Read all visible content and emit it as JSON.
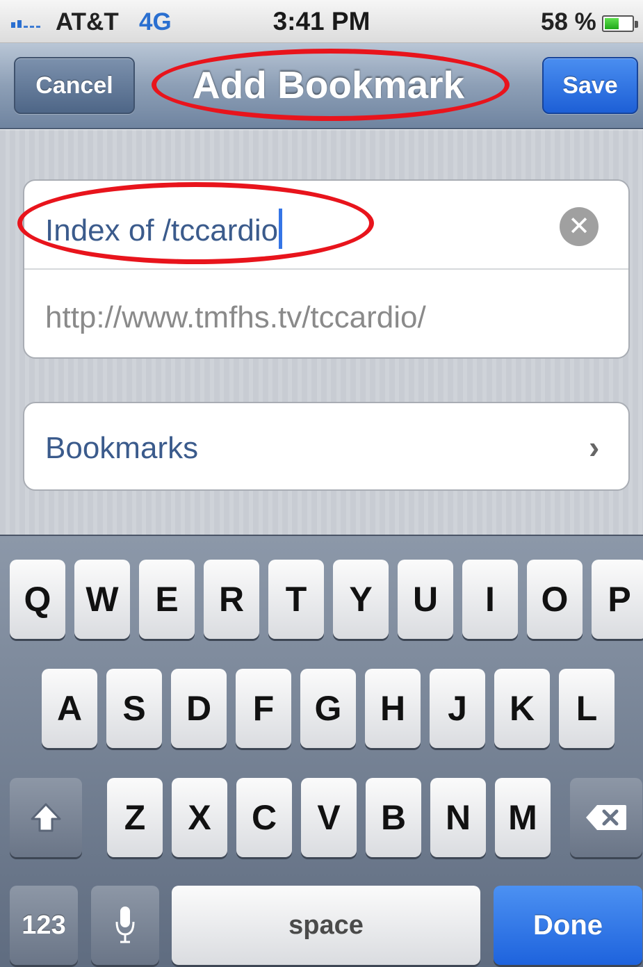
{
  "status_bar": {
    "carrier": "AT&T",
    "network": "4G",
    "time": "3:41 PM",
    "battery_percent": "58 %",
    "battery_level": 0.58
  },
  "nav": {
    "cancel_label": "Cancel",
    "title": "Add Bookmark",
    "save_label": "Save"
  },
  "form": {
    "title_value": "Index of /tccardio",
    "url_value": "http://www.tmfhs.tv/tccardio/",
    "folder_label": "Bookmarks"
  },
  "keyboard": {
    "row1": [
      "Q",
      "W",
      "E",
      "R",
      "T",
      "Y",
      "U",
      "I",
      "O",
      "P"
    ],
    "row2": [
      "A",
      "S",
      "D",
      "F",
      "G",
      "H",
      "J",
      "K",
      "L"
    ],
    "row3": [
      "Z",
      "X",
      "C",
      "V",
      "B",
      "N",
      "M"
    ],
    "numbers_label": "123",
    "space_label": "space",
    "done_label": "Done"
  },
  "colors": {
    "annotation": "#e8141c",
    "accent": "#1d5fd6"
  }
}
